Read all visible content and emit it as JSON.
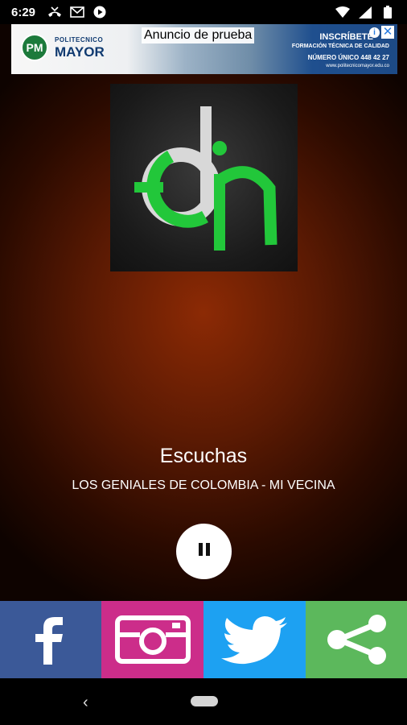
{
  "status_bar": {
    "time": "6:29",
    "icons_left": [
      "missed-call-icon",
      "gmail-icon",
      "play-icon"
    ],
    "icons_right": [
      "wifi-icon",
      "signal-icon",
      "battery-icon"
    ]
  },
  "ad": {
    "label": "Anuncio de prueba",
    "brand_small": "POLITECNICO",
    "brand_big": "MAYOR",
    "logo_text": "PM",
    "cta": "INSCRÍBETE",
    "subtitle": "FORMACIÓN TÉCNICA DE CALIDAD",
    "phone": "NÚMERO ÚNICO 448 42 27",
    "url": "www.politecnicomayor.edu.co",
    "info_glyph": "i",
    "close_glyph": "✕"
  },
  "player": {
    "title": "Escuchas",
    "artist": "LOS GENIALES DE COLOMBIA - MI VECINA"
  },
  "social": [
    "facebook",
    "instagram",
    "twitter",
    "share"
  ],
  "nav": {
    "back_glyph": "‹"
  },
  "colors": {
    "facebook": "#3b5998",
    "instagram": "#cc2d8a",
    "twitter": "#1da1f2",
    "share": "#5cb85c",
    "logo_green": "#22c73a"
  }
}
